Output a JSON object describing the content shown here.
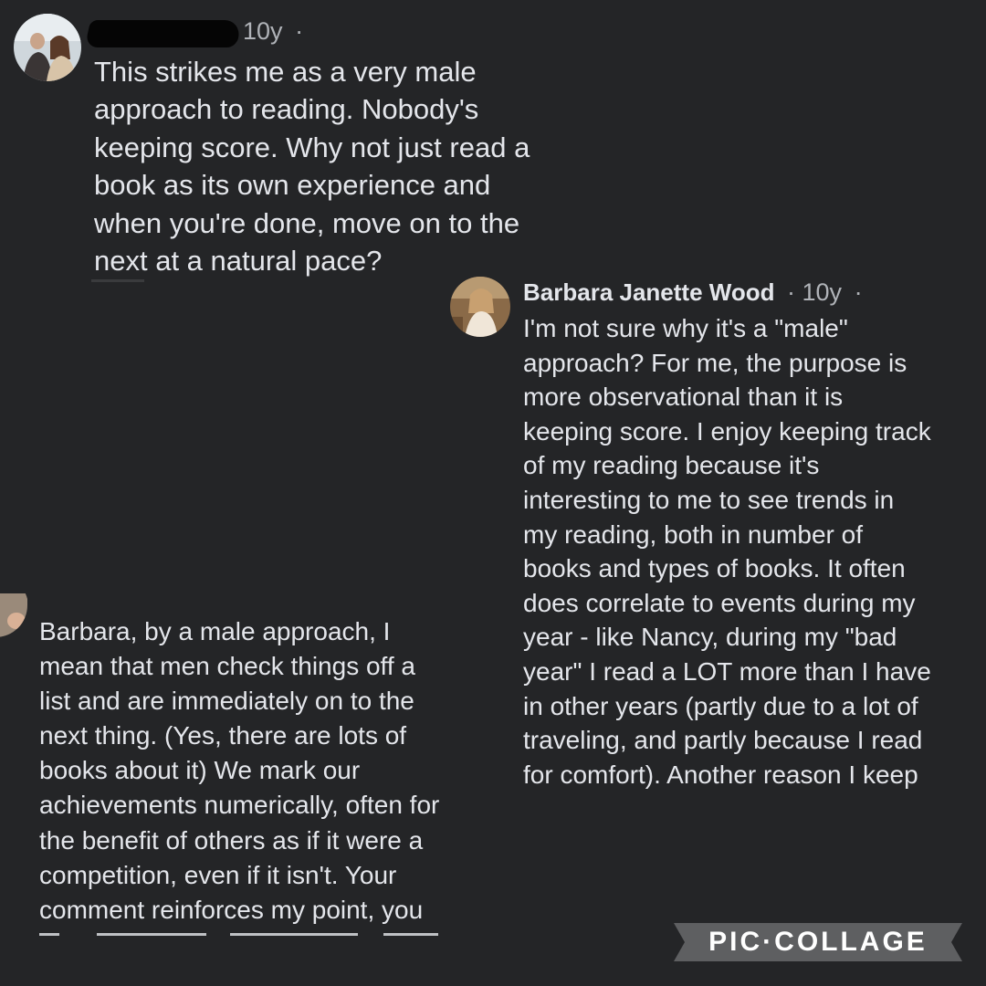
{
  "comments": [
    {
      "author": "",
      "age": "10y",
      "separator": "·",
      "text": "This strikes me as a very male\napproach to reading. Nobody's\nkeeping score. Why not just read a\nbook as its own experience and\nwhen you're done, move on to the\nnext at a natural pace?",
      "avatar_icon": "profile-photo-icon"
    },
    {
      "author": "Barbara Janette Wood",
      "age": "10y",
      "separator": "·",
      "text": "I'm not sure why it's a \"male\"\napproach? For me, the purpose is\nmore observational than it is\nkeeping score. I enjoy keeping track\nof my reading because it's\ninteresting to me to see trends in\nmy reading, both in number of\nbooks and types of books. It often\ndoes correlate to events during my\nyear - like Nancy, during my \"bad\nyear\" I read a LOT more than I have\nin other years (partly due to a lot of\ntraveling, and partly because I read\nfor comfort). Another reason I keep",
      "avatar_icon": "profile-photo-icon"
    },
    {
      "author": "",
      "age": "",
      "text": "Barbara, by a male approach, I\nmean that men check things off a\nlist and are immediately on to the\nnext thing. (Yes, there are lots of\nbooks about it) We mark our\nachievements numerically, often for\nthe benefit of others as if it were a\ncompetition, even if it isn't. Your\ncomment reinforces my point, you",
      "avatar_icon": "profile-photo-icon"
    }
  ],
  "watermark": {
    "text": "PIC·COLLAGE"
  },
  "colors": {
    "background": "#242526",
    "text": "#e4e6eb",
    "secondary_text": "#b0b3b8"
  }
}
